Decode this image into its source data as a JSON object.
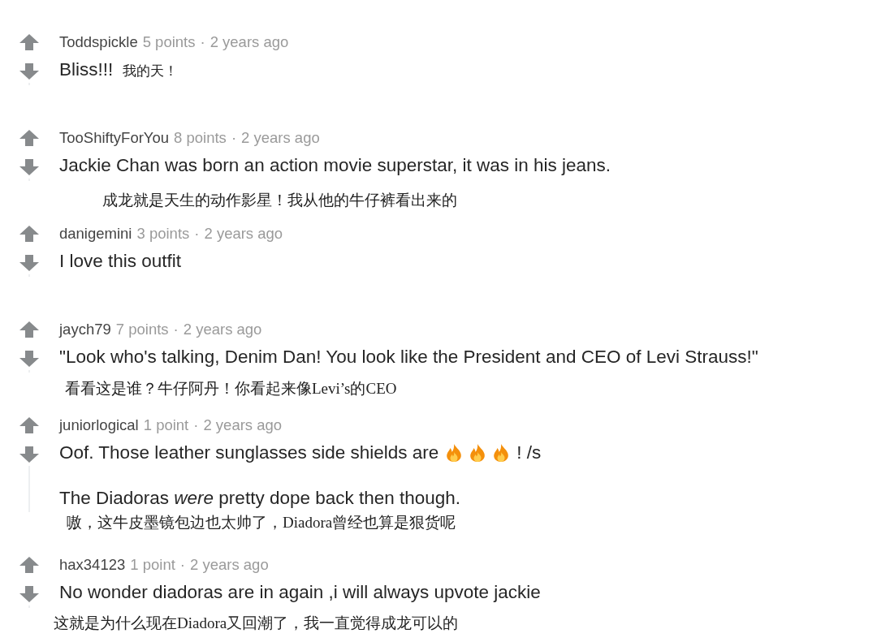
{
  "comments": [
    {
      "username": "Toddspickle",
      "points": "5 points",
      "separator": "·",
      "time": "2 years ago",
      "paragraphs": [
        {
          "parts": [
            {
              "kind": "text",
              "text": "Bliss!!!"
            }
          ]
        }
      ],
      "translation": {
        "kind": "inline",
        "text": "我的天！"
      }
    },
    {
      "username": "TooShiftyForYou",
      "points": "8 points",
      "separator": "·",
      "time": "2 years ago",
      "paragraphs": [
        {
          "parts": [
            {
              "kind": "text",
              "text": "Jackie Chan was born an action movie superstar, it was in his jeans."
            }
          ]
        }
      ],
      "translation": {
        "kind": "below",
        "text": "成龙就是天生的动作影星！我从他的牛仔裤看出来的"
      }
    },
    {
      "username": "danigemini",
      "points": "3 points",
      "separator": "·",
      "time": "2 years ago",
      "paragraphs": [
        {
          "parts": [
            {
              "kind": "text",
              "text": "I love this outfit"
            }
          ]
        }
      ]
    },
    {
      "username": "jaych79",
      "points": "7 points",
      "separator": "·",
      "time": "2 years ago",
      "paragraphs": [
        {
          "parts": [
            {
              "kind": "text",
              "text": "\"Look who's talking, Denim Dan! You look like the President and CEO of Levi Strauss!\""
            }
          ]
        }
      ],
      "translation": {
        "kind": "below",
        "text": "看看这是谁？牛仔阿丹！你看起来像Levi’s的CEO"
      }
    },
    {
      "username": "juniorlogical",
      "points": "1 point",
      "separator": "·",
      "time": "2 years ago",
      "paragraphs": [
        {
          "parts": [
            {
              "kind": "text",
              "text": "Oof. Those leather sunglasses side shields are"
            },
            {
              "kind": "fire"
            },
            {
              "kind": "fire"
            },
            {
              "kind": "fire"
            },
            {
              "kind": "text",
              "text": "! /s"
            }
          ]
        },
        {
          "parts": [
            {
              "kind": "text",
              "text": "The Diadoras *were* pretty dope back then though."
            }
          ]
        }
      ],
      "translation": {
        "kind": "below",
        "text": "嗷，这牛皮墨镜包边也太帅了，Diadora曾经也算是狠货呢"
      }
    },
    {
      "username": "hax34123",
      "points": "1 point",
      "separator": "·",
      "time": "2 years ago",
      "paragraphs": [
        {
          "parts": [
            {
              "kind": "text",
              "text": "No wonder diadoras are in again ,i will always upvote jackie"
            }
          ]
        }
      ],
      "translation": {
        "kind": "below",
        "text": "这就是为什么现在Diadora又回潮了，我一直觉得成龙可以的"
      }
    }
  ]
}
